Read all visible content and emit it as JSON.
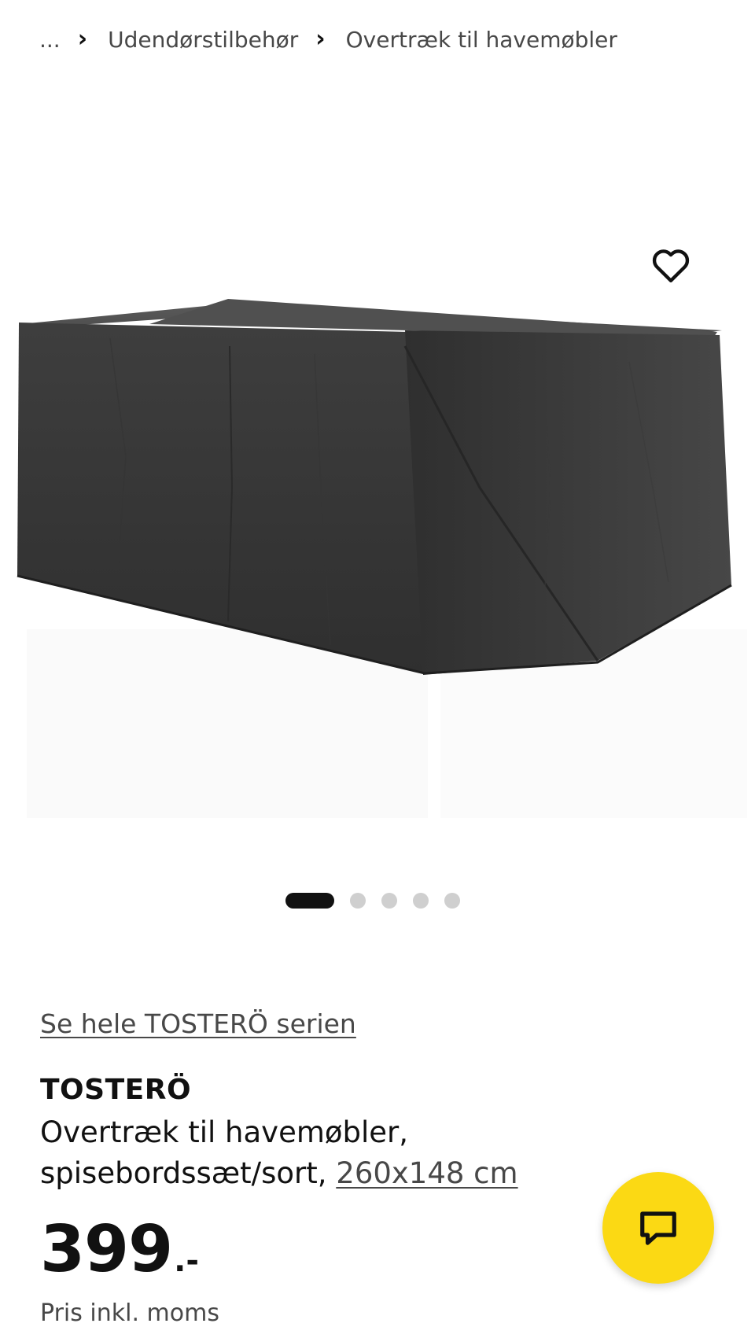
{
  "breadcrumb": {
    "ellipsis": "...",
    "items": [
      {
        "label": "Udendørstilbehør"
      },
      {
        "label": "Overtræk til havemøbler"
      }
    ]
  },
  "gallery": {
    "image_count": 5,
    "active_index": 0,
    "favorite_icon": "heart-outline-icon"
  },
  "product": {
    "series_link": "Se hele TOSTERÖ serien",
    "name": "TOSTERÖ",
    "description_line1": "Overtræk til havemøbler,",
    "description_line2": "spisebordssæt/sort, ",
    "size_link": "260x148 cm",
    "price_integer": "399",
    "price_suffix": ".-",
    "price_note": "Pris inkl. moms"
  },
  "chat": {
    "icon": "chat-bubble-icon",
    "color": "#fbd914"
  }
}
